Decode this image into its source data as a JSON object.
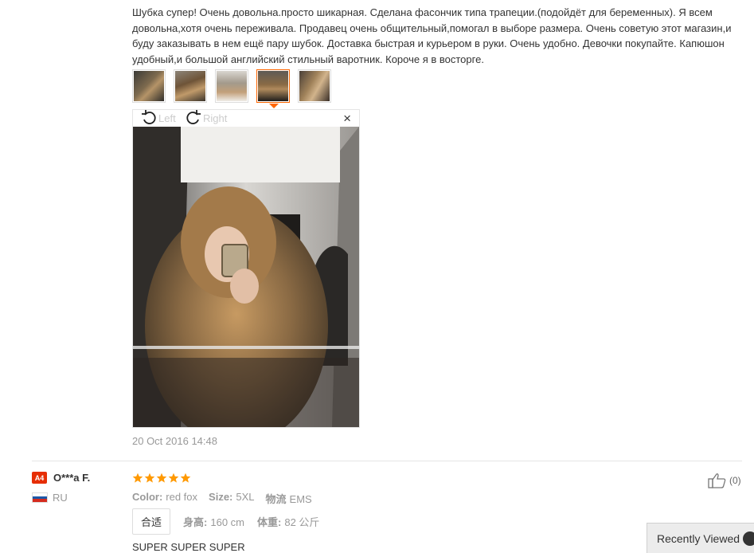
{
  "review1": {
    "text": "Шубка супер! Очень довольна.просто шикарная. Сделана фасончик типа трапеции.(подойдёт для беременных). Я всем довольна,хотя очень переживала. Продавец очень общительный,помогал в выборе размера. Очень советую этот магазин,и буду заказывать в нем ещё пару шубок. Доставка быстрая и курьером в руки. Очень удобно. Девочки покупайте. Капюшон удобный,и большой английский стильный варотник. Короче я в восторге.",
    "thumbnails_count": 5,
    "active_thumbnail": 4,
    "viewer": {
      "rotate_left_label": "Left",
      "rotate_right_label": "Right",
      "close_label": "×"
    },
    "date": "20 Oct 2016 14:48"
  },
  "review2": {
    "badge": "A4",
    "user_name": "O***a F.",
    "country": "RU",
    "rating": 5,
    "color_label": "Color:",
    "color_value": "red fox",
    "size_label": "Size:",
    "size_value": "5XL",
    "logistics_label": "物流",
    "logistics_value": "EMS",
    "fit_tag": "合适",
    "height_label": "身高:",
    "height_value": "160 cm",
    "weight_label": "体重:",
    "weight_value": "82 公斤",
    "text": "SUPER SUPER SUPER",
    "helpful_count": "(0)"
  },
  "recently_viewed": "Recently Viewed",
  "colors": {
    "accent": "#ff6600",
    "star": "#ff9900",
    "badge": "#e62e04"
  }
}
